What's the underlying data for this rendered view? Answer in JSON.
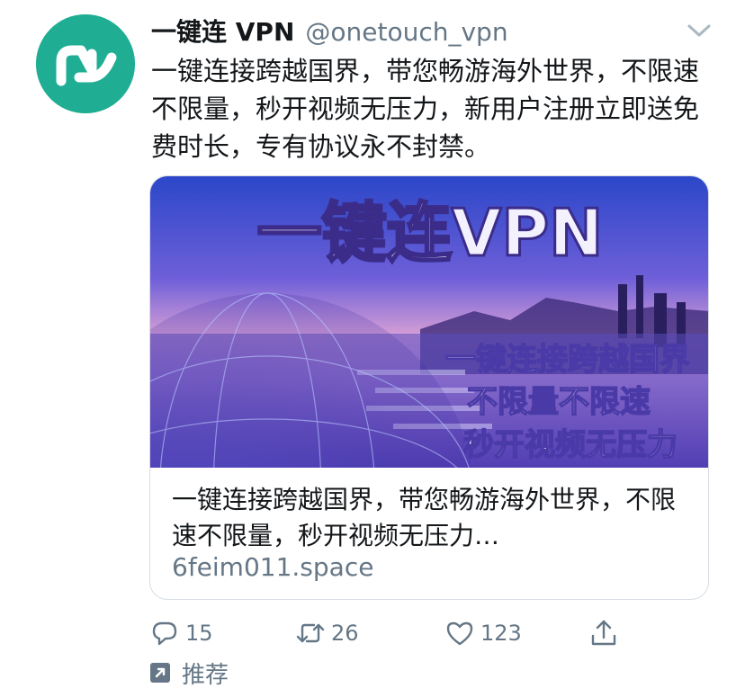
{
  "tweet": {
    "display_name": "一键连 VPN",
    "handle": "@onetouch_vpn",
    "text": "一键连接跨越国界，带您畅游海外世界，不限速不限量，秒开视频无压力，新用户注册立即送免费时长，专有协议永不封禁。"
  },
  "card": {
    "image_title": "一键连VPN",
    "image_lines": [
      "一键连接跨越国界",
      "不限量不限速",
      "秒开视频无压力"
    ],
    "description": "一键连接跨越国界，带您畅游海外世界，不限速不限量，秒开视频无压力…",
    "domain": "6feim011.space"
  },
  "actions": {
    "reply_count": "15",
    "retweet_count": "26",
    "like_count": "123"
  },
  "promoted_label": "推荐",
  "colors": {
    "avatar_bg": "#1fae93",
    "text": "#14171a",
    "muted": "#657786",
    "border": "#d6dde3"
  },
  "icons": [
    "avatar-logo",
    "chevron-down-icon",
    "reply-icon",
    "retweet-icon",
    "heart-icon",
    "share-icon",
    "promoted-icon"
  ]
}
